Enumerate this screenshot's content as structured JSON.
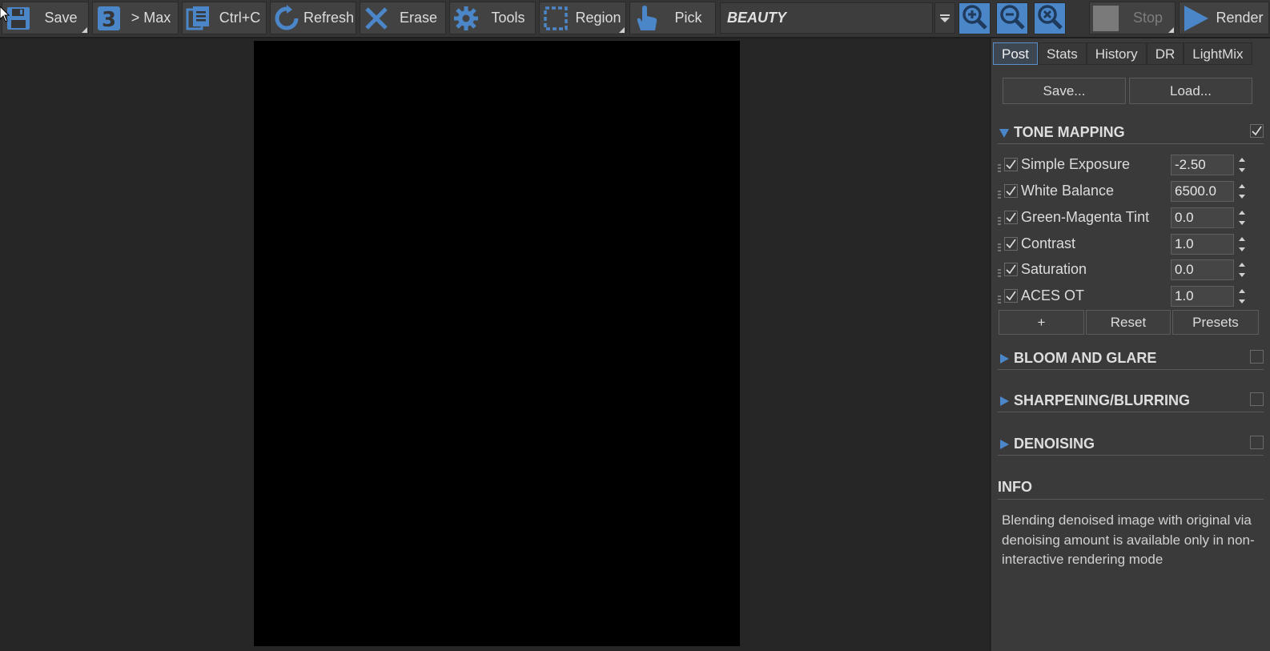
{
  "toolbar": {
    "save_label": "Save",
    "max_label": "> Max",
    "copy_label": "Ctrl+C",
    "refresh_label": "Refresh",
    "erase_label": "Erase",
    "tools_label": "Tools",
    "region_label": "Region",
    "pick_label": "Pick",
    "render_element": "BEAUTY",
    "stop_label": "Stop",
    "render_label": "Render"
  },
  "icons": {
    "save": "floppy-disk-icon",
    "max": "3ds-max-icon",
    "copy": "copy-icon",
    "refresh": "refresh-icon",
    "erase": "erase-x-icon",
    "tools": "gear-icon",
    "region": "region-select-icon",
    "pick": "hand-pointer-icon",
    "zoom_in": "zoom-in-icon",
    "zoom_out": "zoom-out-icon",
    "zoom_reset": "zoom-reset-icon",
    "render": "play-icon"
  },
  "colors": {
    "accent": "#4a86c8",
    "panel_bg": "#3a3a3a",
    "viewport_bg": "#262626",
    "render_bg": "#000000"
  },
  "panel": {
    "tabs": [
      {
        "label": "Post",
        "active": true
      },
      {
        "label": "Stats"
      },
      {
        "label": "History"
      },
      {
        "label": "DR"
      },
      {
        "label": "LightMix"
      }
    ],
    "save_label": "Save...",
    "load_label": "Load...",
    "tone_mapping": {
      "title": "TONE MAPPING",
      "enabled": true,
      "operators": [
        {
          "label": "Simple Exposure",
          "value": "-2.50",
          "checked": true
        },
        {
          "label": "White Balance",
          "value": "6500.0",
          "checked": true
        },
        {
          "label": "Green-Magenta Tint",
          "value": "0.0",
          "checked": true
        },
        {
          "label": "Contrast",
          "value": "1.0",
          "checked": true
        },
        {
          "label": "Saturation",
          "value": "0.0",
          "checked": true
        },
        {
          "label": "ACES OT",
          "value": "1.0",
          "checked": true
        }
      ],
      "add_label": "+",
      "reset_label": "Reset",
      "presets_label": "Presets"
    },
    "sections": [
      {
        "title": "BLOOM AND GLARE",
        "enabled": false
      },
      {
        "title": "SHARPENING/BLURRING",
        "enabled": false
      },
      {
        "title": "DENOISING",
        "enabled": false
      }
    ],
    "info": {
      "title": "INFO",
      "text": "Blending denoised image with original via denoising amount is available only in non-interactive rendering mode"
    }
  }
}
